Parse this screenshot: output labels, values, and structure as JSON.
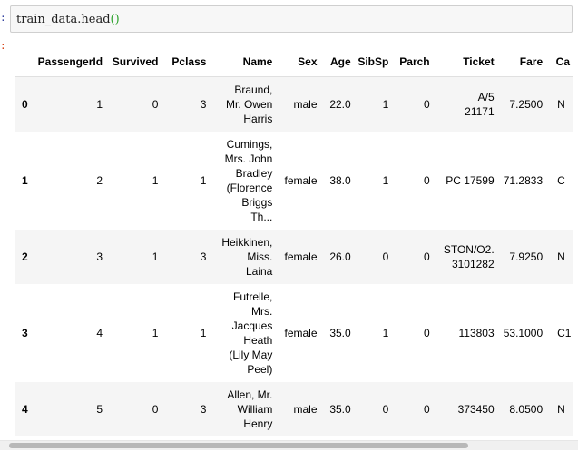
{
  "input": {
    "prompt": ":",
    "code_text": "train_data.head",
    "code_parens": "()"
  },
  "output": {
    "prompt": ":"
  },
  "table": {
    "columns": [
      "",
      "PassengerId",
      "Survived",
      "Pclass",
      "Name",
      "Sex",
      "Age",
      "SibSp",
      "Parch",
      "Ticket",
      "Fare",
      "Ca"
    ],
    "rows": [
      {
        "index": "0",
        "cells": [
          "1",
          "0",
          "3"
        ],
        "name_lines": [
          "Braund,",
          "Mr. Owen",
          "Harris"
        ],
        "sex": "male",
        "age": "22.0",
        "sibsp": "1",
        "parch": "0",
        "ticket_lines": [
          "A/5",
          "21171"
        ],
        "fare": "7.2500",
        "cabin": "N"
      },
      {
        "index": "1",
        "cells": [
          "2",
          "1",
          "1"
        ],
        "name_lines": [
          "Cumings,",
          "Mrs. John",
          "Bradley",
          "(Florence",
          "Briggs",
          "Th..."
        ],
        "sex": "female",
        "age": "38.0",
        "sibsp": "1",
        "parch": "0",
        "ticket_lines": [
          "PC 17599"
        ],
        "fare": "71.2833",
        "cabin": "C"
      },
      {
        "index": "2",
        "cells": [
          "3",
          "1",
          "3"
        ],
        "name_lines": [
          "Heikkinen,",
          "Miss.",
          "Laina"
        ],
        "sex": "female",
        "age": "26.0",
        "sibsp": "0",
        "parch": "0",
        "ticket_lines": [
          "STON/O2.",
          "3101282"
        ],
        "fare": "7.9250",
        "cabin": "N"
      },
      {
        "index": "3",
        "cells": [
          "4",
          "1",
          "1"
        ],
        "name_lines": [
          "Futrelle,",
          "Mrs.",
          "Jacques",
          "Heath",
          "(Lily May",
          "Peel)"
        ],
        "sex": "female",
        "age": "35.0",
        "sibsp": "1",
        "parch": "0",
        "ticket_lines": [
          "113803"
        ],
        "fare": "53.1000",
        "cabin": "C1"
      },
      {
        "index": "4",
        "cells": [
          "5",
          "0",
          "3"
        ],
        "name_lines": [
          "Allen, Mr.",
          "William",
          "Henry"
        ],
        "sex": "male",
        "age": "35.0",
        "sibsp": "0",
        "parch": "0",
        "ticket_lines": [
          "373450"
        ],
        "fare": "8.0500",
        "cabin": "N"
      }
    ]
  },
  "scrollbar": {
    "position_fraction": 0.0,
    "visible_fraction": 0.82
  }
}
